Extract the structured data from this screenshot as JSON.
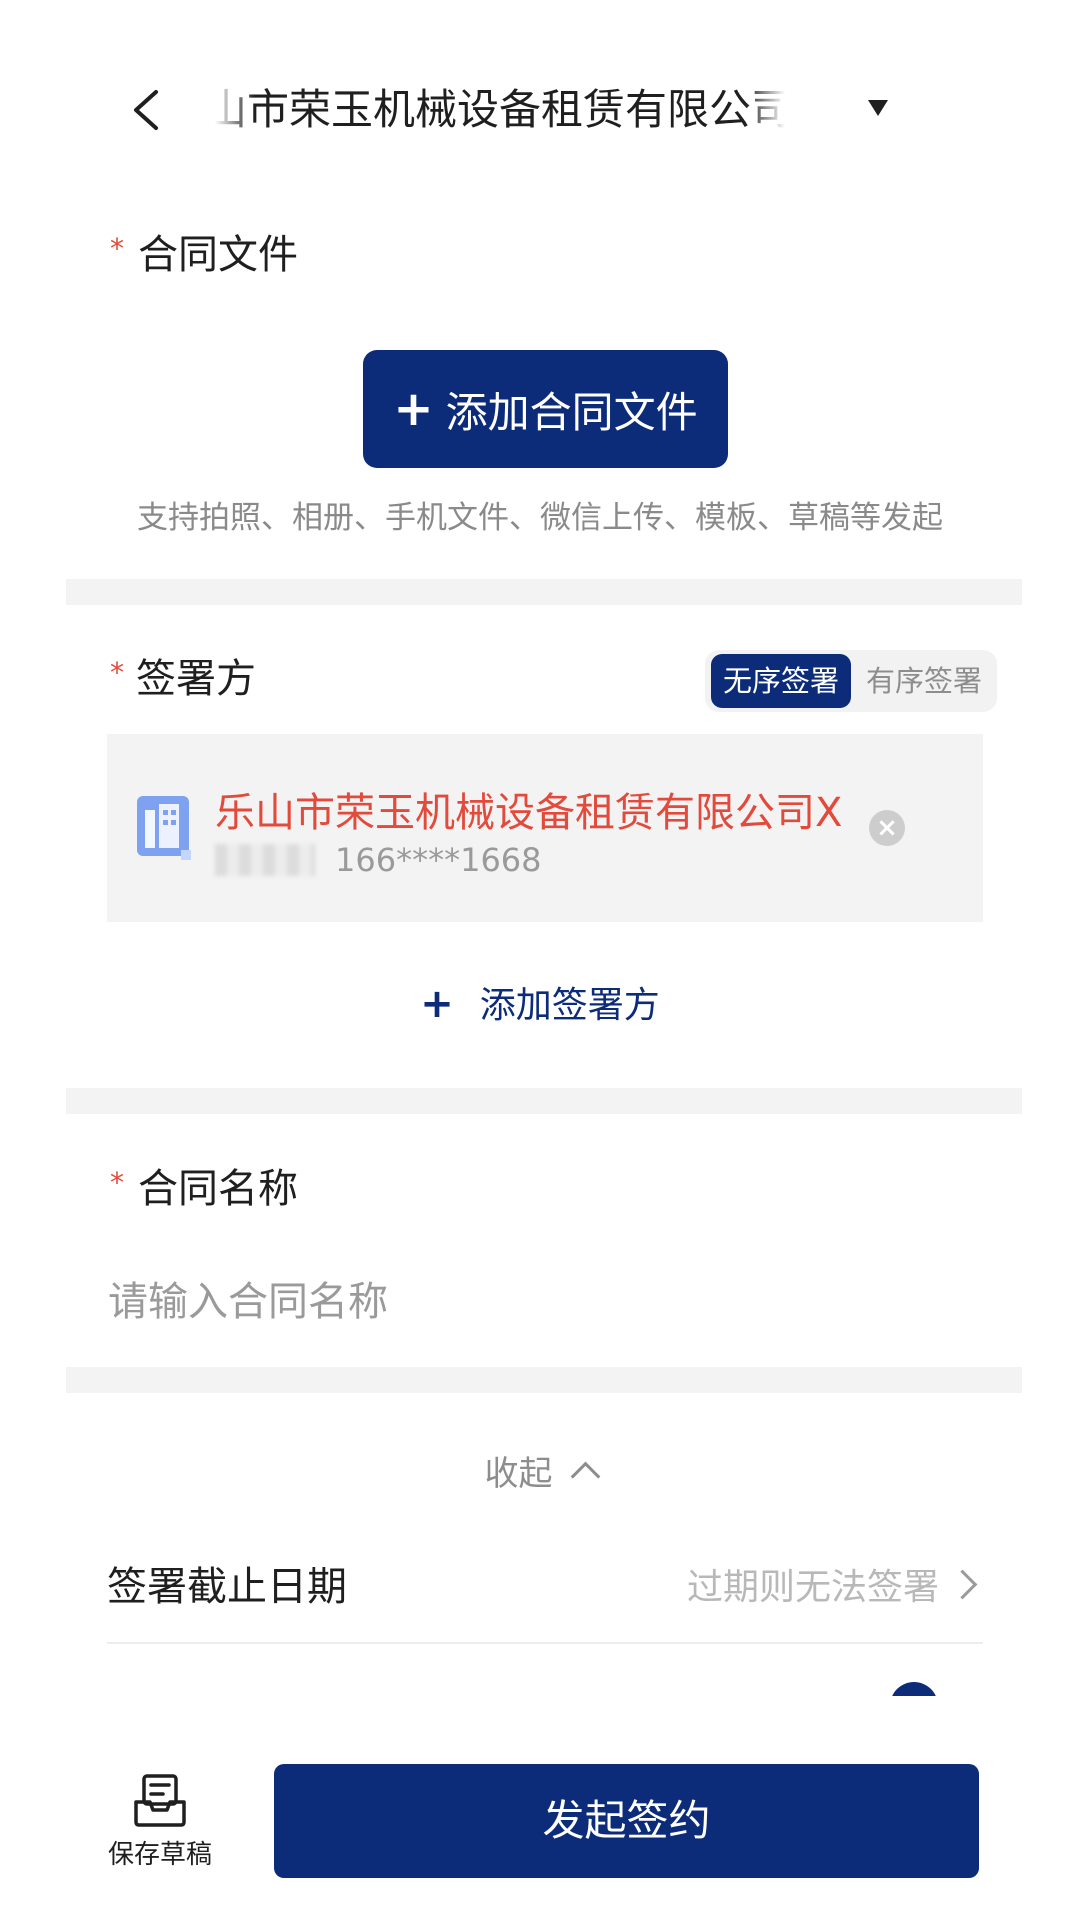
{
  "header": {
    "title": "乐山市荣玉机械设备租赁有限公司X（代"
  },
  "contract_file": {
    "label": "合同文件",
    "required_mark": "*",
    "add_button_label": "添加合同文件",
    "add_button_icon": "plus-icon",
    "hint": "支持拍照、相册、手机文件、微信上传、模板、草稿等发起"
  },
  "signers": {
    "label": "签署方",
    "required_mark": "*",
    "mode_options": [
      "无序签署",
      "有序签署"
    ],
    "selected_mode": "无序签署",
    "list": [
      {
        "name": "乐山市荣玉机械设备租赁有限公司X",
        "phone": "166****1668",
        "icon": "company-building-icon"
      }
    ],
    "add_label": "添加签署方"
  },
  "contract_name": {
    "label": "合同名称",
    "required_mark": "*",
    "placeholder": "请输入合同名称",
    "value": ""
  },
  "options": {
    "collapse_label": "收起",
    "deadline_label": "签署截止日期",
    "deadline_hint": "过期则无法签署"
  },
  "footer": {
    "save_draft_label": "保存草稿",
    "submit_label": "发起签约"
  },
  "colors": {
    "primary": "#0c2c7a",
    "required": "#e24a3b",
    "signer_name": "#e24a3b",
    "divider": "#f3f3f3"
  }
}
